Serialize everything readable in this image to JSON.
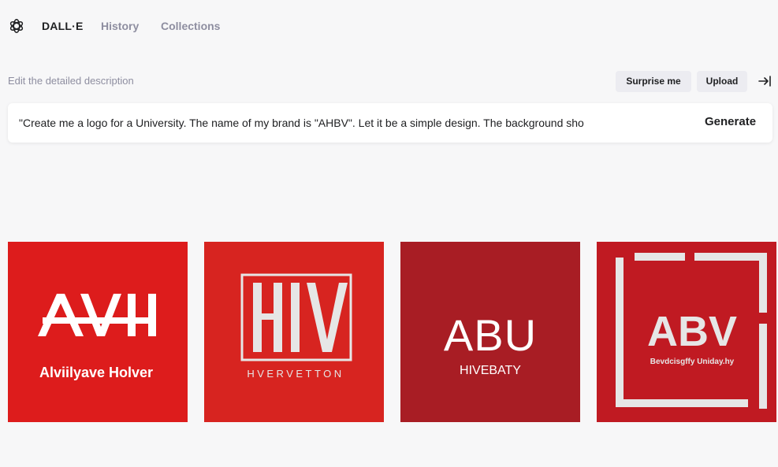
{
  "nav": {
    "brand": "DALL·E",
    "history": "History",
    "collections": "Collections"
  },
  "prompt": {
    "hint": "Edit the detailed description",
    "surprise_label": "Surprise me",
    "upload_label": "Upload",
    "text": "\"Create me a logo for a University. The name of my brand is \"AHBV\". Let it be a simple design. The background sho",
    "generate_label": "Generate"
  },
  "results": [
    {
      "monogram": "AVH",
      "subtitle": "Alviilyave Holver",
      "background": "#dd1c1c"
    },
    {
      "monogram": "HIV",
      "subtitle": "HVERVETTON",
      "background": "#d72420"
    },
    {
      "monogram": "ABU",
      "subtitle": "HIVEBATY",
      "background": "#a81d24"
    },
    {
      "monogram": "ABV",
      "subtitle": "Bevdcisgffy Uniday.hy",
      "background": "#c01a22"
    }
  ],
  "icons": {
    "logo": "openai-logo-icon",
    "collapse": "arrow-right-to-line-icon"
  },
  "colors": {
    "background": "#f7f7f8",
    "muted_text": "#8e8ea0",
    "chip_bg": "#ececf1"
  }
}
